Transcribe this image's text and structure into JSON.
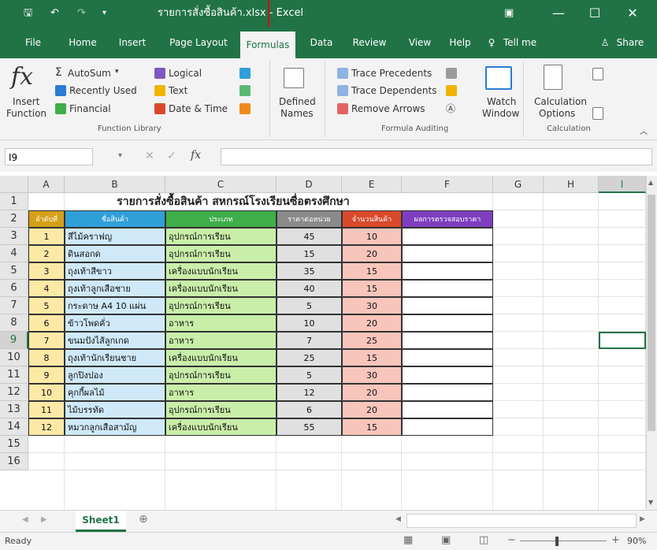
{
  "window": {
    "title": "รายการสั่งซื้อสินค้า.xlsx - Excel",
    "tell_me": "Tell me",
    "share": "Share"
  },
  "tabs": [
    "File",
    "Home",
    "Insert",
    "Page Layout",
    "Formulas",
    "Data",
    "Review",
    "View",
    "Help"
  ],
  "active_tab": "Formulas",
  "ribbon": {
    "insert_function": {
      "line1": "Insert",
      "line2": "Function"
    },
    "autosum": "AutoSum",
    "recently_used": "Recently Used",
    "financial": "Financial",
    "logical": "Logical",
    "text": "Text",
    "date_time": "Date & Time",
    "function_library_label": "Function Library",
    "defined_names": {
      "line1": "Defined",
      "line2": "Names"
    },
    "trace_precedents": "Trace Precedents",
    "trace_dependents": "Trace Dependents",
    "remove_arrows": "Remove Arrows",
    "formula_auditing_label": "Formula Auditing",
    "watch_window": {
      "line1": "Watch",
      "line2": "Window"
    },
    "calculation_options": {
      "line1": "Calculation",
      "line2": "Options"
    },
    "calculation_label": "Calculation"
  },
  "formula_bar": {
    "name_box": "I9",
    "fx": "fx",
    "value": ""
  },
  "columns": [
    "A",
    "B",
    "C",
    "D",
    "E",
    "F",
    "G",
    "H",
    "I"
  ],
  "rows": [
    "1",
    "2",
    "3",
    "4",
    "5",
    "6",
    "7",
    "8",
    "9",
    "10",
    "11",
    "12",
    "13",
    "14",
    "15",
    "16"
  ],
  "sheet_title": "รายการสั่งซื้อสินค้า สหกรณ์โรงเรียนซื่อตรงศึกษา",
  "headers": [
    "ลำดับที่",
    "ชื่อสินค้า",
    "ประเภท",
    "ราคาต่อหน่วย",
    "จำนวนสินค้า",
    "ผลการตรวจสอบราคา"
  ],
  "table_rows": [
    [
      "1",
      "สีไม้คราฟญ",
      "อุปกรณ์การเรียน",
      "45",
      "10",
      ""
    ],
    [
      "2",
      "ดินสอกด",
      "อุปกรณ์การเรียน",
      "15",
      "20",
      ""
    ],
    [
      "3",
      "ถุงเท้าสีขาว",
      "เครื่องแบบนักเรียน",
      "35",
      "15",
      ""
    ],
    [
      "4",
      "ถุงเท้าลูกเสือชาย",
      "เครื่องแบบนักเรียน",
      "40",
      "15",
      ""
    ],
    [
      "5",
      "กระดาษ A4 10 แผ่น",
      "อุปกรณ์การเรียน",
      "5",
      "30",
      ""
    ],
    [
      "6",
      "ข้าวโพดคั่ว",
      "อาหาร",
      "10",
      "20",
      ""
    ],
    [
      "7",
      "ขนมปังไส้ลูกเกด",
      "อาหาร",
      "7",
      "25",
      ""
    ],
    [
      "8",
      "ถุงเท้านักเรียนชาย",
      "เครื่องแบบนักเรียน",
      "25",
      "15",
      ""
    ],
    [
      "9",
      "ลูกปิงปอง",
      "อุปกรณ์การเรียน",
      "5",
      "30",
      ""
    ],
    [
      "10",
      "คุกกี้ผลไม้",
      "อาหาร",
      "12",
      "20",
      ""
    ],
    [
      "11",
      "ไม้บรรทัด",
      "อุปกรณ์การเรียน",
      "6",
      "20",
      ""
    ],
    [
      "12",
      "หมวกลูกเสือสามัญ",
      "เครื่องแบบนักเรียน",
      "55",
      "15",
      ""
    ]
  ],
  "sheet_tab": "Sheet1",
  "status": {
    "ready": "Ready",
    "zoom": "90%"
  },
  "colors": {
    "excel_green": "#217346",
    "hdr_a": "#d4a017",
    "hdr_b": "#2f9fd8",
    "hdr_c": "#3fae49",
    "hdr_d": "#8a8a8a",
    "hdr_e": "#d9492b",
    "hdr_f": "#7e3fbf",
    "fill_a": "#fde9a6",
    "fill_b": "#cfe9f8",
    "fill_c": "#c9eea9",
    "fill_d": "#e0e0e0",
    "fill_e": "#f8c5bb"
  }
}
